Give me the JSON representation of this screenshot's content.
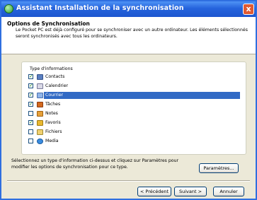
{
  "window": {
    "title": "Assistant Installation de la synchronisation",
    "close_glyph": "x"
  },
  "header": {
    "heading": "Options de Synchronisation",
    "description": "Le Pocket PC est déjà configuré pour se synchroniser avec un autre ordinateur. Les éléments sélectionnés seront synchronisés avec tous les ordinateurs."
  },
  "info_types": {
    "legend": "Type d'informations",
    "items": [
      {
        "label": "Contacts",
        "checked": true,
        "icon": "contacts-icon",
        "icon_color": "#5a7fc0"
      },
      {
        "label": "Calendrier",
        "checked": true,
        "icon": "calendar-icon",
        "icon_color": "#d9d9e6"
      },
      {
        "label": "Courrier",
        "checked": true,
        "icon": "mail-icon",
        "icon_color": "#8fb4e8",
        "selected": true
      },
      {
        "label": "Tâches",
        "checked": true,
        "icon": "tasks-icon",
        "icon_color": "#d2691e"
      },
      {
        "label": "Notes",
        "checked": false,
        "icon": "notes-icon",
        "icon_color": "#e6a13a"
      },
      {
        "label": "Favoris",
        "checked": true,
        "icon": "favorites-icon",
        "icon_color": "#e8b830"
      },
      {
        "label": "Fichiers",
        "checked": false,
        "icon": "files-icon",
        "icon_color": "#f0d070"
      },
      {
        "label": "Media",
        "checked": false,
        "icon": "media-icon",
        "icon_color": "#3a8de0"
      }
    ]
  },
  "instructions": "Sélectionnez un type d'information ci-dessus et cliquez sur Paramètres pour modifier les options de synchronisation pour ce type.",
  "buttons": {
    "settings": "Paramètres...",
    "back": "< Précédent",
    "next": "Suivant >",
    "cancel": "Annuler"
  },
  "colors": {
    "title_bar": "#2563dc",
    "selection": "#316ac5",
    "dialog_bg": "#ece9d8"
  }
}
